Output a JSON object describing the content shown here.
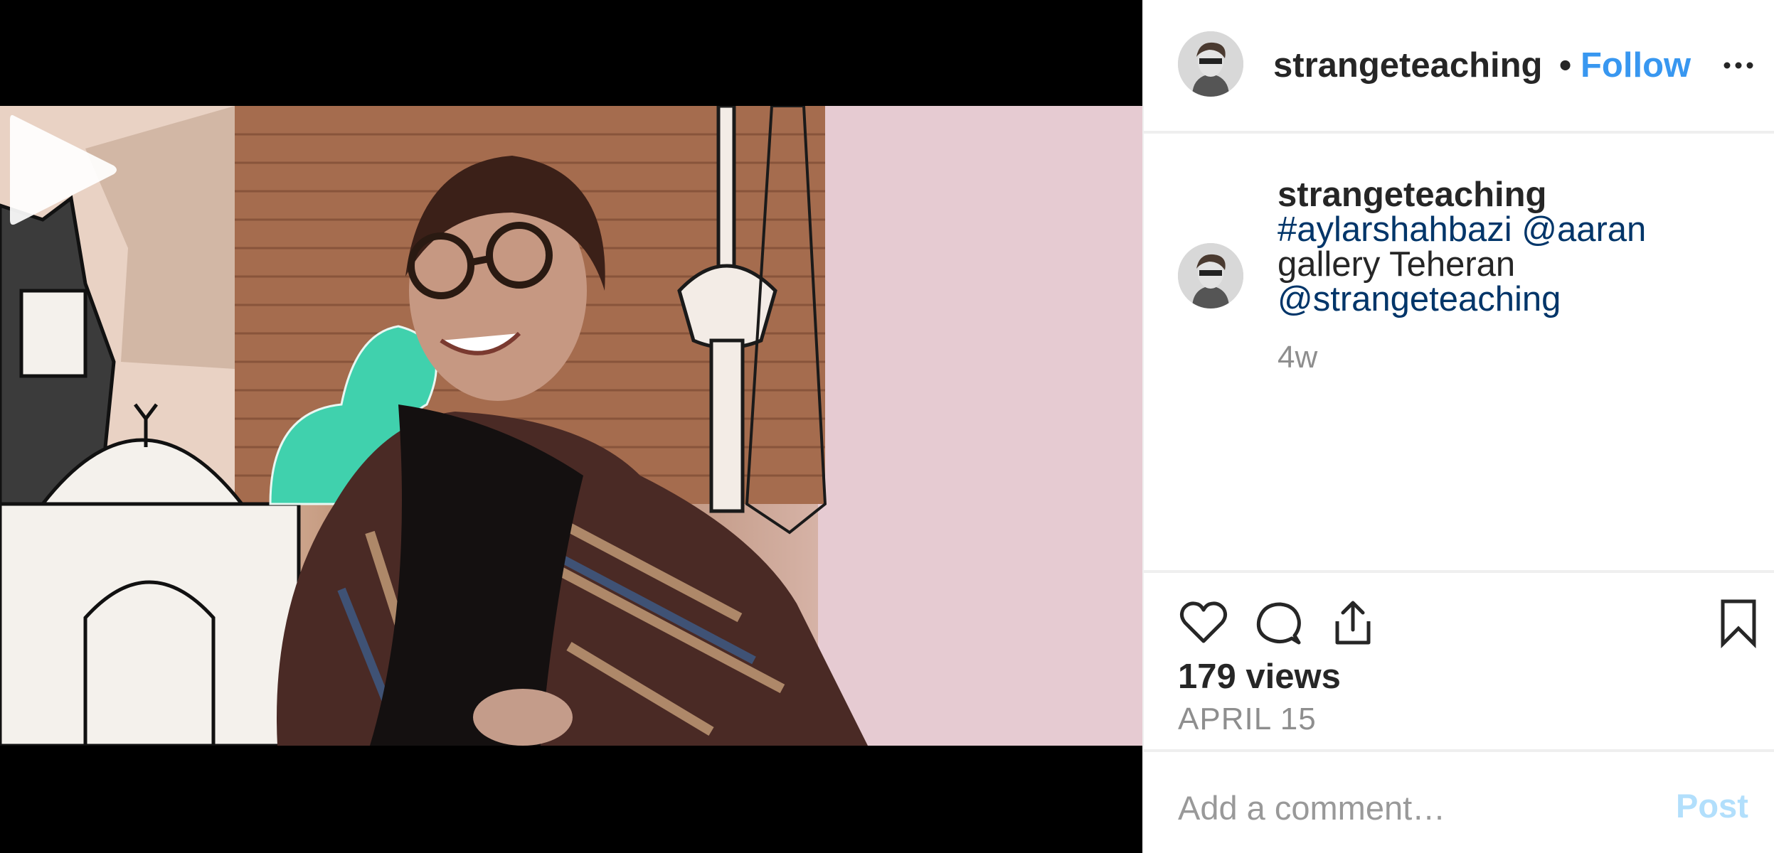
{
  "post": {
    "username": "strangeteaching",
    "separator": "•",
    "follow_label": "Follow",
    "more_icon": "more-options-icon"
  },
  "caption": {
    "username": "strangeteaching",
    "hashtag": "#aylarshahbazi",
    "mention_1": "@aaran",
    "text": "gallery Teheran",
    "mention_2": "@strangeteaching",
    "time": "4w"
  },
  "actions": {
    "like_icon": "heart-icon",
    "comment_icon": "comment-icon",
    "share_icon": "share-icon",
    "save_icon": "bookmark-icon"
  },
  "stats": {
    "views": "179 views",
    "date": "APRIL 15"
  },
  "comment_box": {
    "placeholder": "Add a comment…",
    "post_label": "Post"
  },
  "colors": {
    "link_blue": "#3897f0",
    "tag_blue": "#003569",
    "post_disabled": "#b2dffc",
    "meta_gray": "#8e8e8e"
  }
}
